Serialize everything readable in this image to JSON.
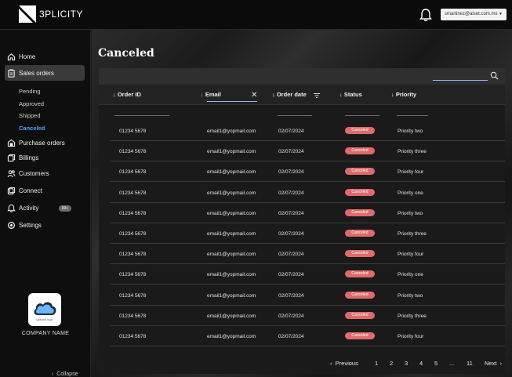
{
  "app": {
    "brand": "3PLICITY",
    "user_email": "smartinez@alset.com.mx"
  },
  "sidebar": {
    "items": [
      {
        "label": "Home",
        "icon": "home-icon"
      },
      {
        "label": "Sales orders",
        "icon": "sales-orders-icon",
        "active": true
      },
      {
        "label": "Purchase orders",
        "icon": "purchase-orders-icon"
      },
      {
        "label": "Billings",
        "icon": "billings-icon"
      },
      {
        "label": "Customers",
        "icon": "customers-icon"
      },
      {
        "label": "Connect",
        "icon": "connect-icon"
      },
      {
        "label": "Activity",
        "icon": "bell-icon",
        "badge": "99+"
      },
      {
        "label": "Settings",
        "icon": "gear-icon"
      }
    ],
    "sub_items": [
      {
        "label": "Pending"
      },
      {
        "label": "Approved"
      },
      {
        "label": "Shipped"
      },
      {
        "label": "Canceled",
        "active": true
      }
    ],
    "upload_label": "Upload logo",
    "company_name": "COMPANY NAME",
    "collapse_label": "Collapse"
  },
  "main": {
    "title": "Canceled",
    "columns": [
      {
        "label": "Order ID"
      },
      {
        "label": "Email"
      },
      {
        "label": "Order date"
      },
      {
        "label": "Status"
      },
      {
        "label": "Priority"
      }
    ],
    "rows": [
      {
        "id": "01234 5678",
        "email": "email1@yopmail.com",
        "date": "02/07/2024",
        "status": "Canceled",
        "priority": "Priority two"
      },
      {
        "id": "01234 5678",
        "email": "email1@yopmail.com",
        "date": "02/07/2024",
        "status": "Canceled",
        "priority": "Priority three"
      },
      {
        "id": "01234 5678",
        "email": "email1@yopmail.com",
        "date": "02/07/2024",
        "status": "Canceled",
        "priority": "Priority four"
      },
      {
        "id": "01234 5678",
        "email": "email1@yopmail.com",
        "date": "02/07/2024",
        "status": "Canceled",
        "priority": "Priority one"
      },
      {
        "id": "01234 5678",
        "email": "email1@yopmail.com",
        "date": "02/07/2024",
        "status": "Canceled",
        "priority": "Priority two"
      },
      {
        "id": "01234 5678",
        "email": "email1@yopmail.com",
        "date": "02/07/2024",
        "status": "Canceled",
        "priority": "Priority three"
      },
      {
        "id": "01234 5678",
        "email": "email1@yopmail.com",
        "date": "02/07/2024",
        "status": "Canceled",
        "priority": "Priority four"
      },
      {
        "id": "01234 5678",
        "email": "email1@yopmail.com",
        "date": "02/07/2024",
        "status": "Canceled",
        "priority": "Priority one"
      },
      {
        "id": "01234 5678",
        "email": "email1@yopmail.com",
        "date": "02/07/2024",
        "status": "Canceled",
        "priority": "Priority two"
      },
      {
        "id": "01234 5678",
        "email": "email1@yopmail.com",
        "date": "02/07/2024",
        "status": "Canceled",
        "priority": "Priority three"
      },
      {
        "id": "01234 5678",
        "email": "email1@yopmail.com",
        "date": "02/07/2024",
        "status": "Canceled",
        "priority": "Priority four"
      }
    ],
    "pagination": {
      "previous": "Previous",
      "pages": [
        "1",
        "2",
        "3",
        "4",
        "5",
        "...",
        "11"
      ],
      "next": "Next"
    }
  },
  "colors": {
    "accent": "#4da3ff",
    "status_canceled": "#e06a6a",
    "topbar": "#0b0b0b"
  }
}
